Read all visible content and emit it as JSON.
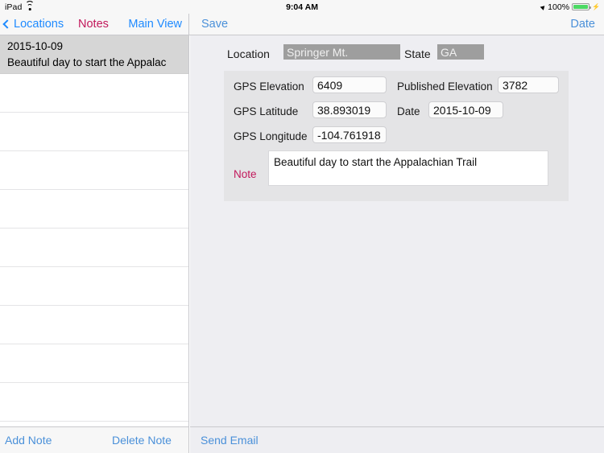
{
  "status_bar": {
    "device": "iPad",
    "wifi_icon": "wifi-icon",
    "time": "9:04 AM",
    "location_icon": "location-arrow-icon",
    "battery_percent": "100%",
    "battery_icon": "battery-icon",
    "charging_icon": "charging-bolt-icon",
    "battery_color": "#4cd964"
  },
  "nav_bar": {
    "back_label": "Locations",
    "back_icon": "chevron-left-icon",
    "title": "Notes",
    "title_color": "#c2185b",
    "main_view_label": "Main View",
    "save_label": "Save",
    "date_label": "Date",
    "tint_color": "#4a90d9"
  },
  "sidebar": {
    "notes": [
      {
        "date": "2015-10-09",
        "preview": "Beautiful day to start the Appalac",
        "selected": true
      },
      {
        "date": "",
        "preview": "",
        "selected": false
      },
      {
        "date": "",
        "preview": "",
        "selected": false
      },
      {
        "date": "",
        "preview": "",
        "selected": false
      },
      {
        "date": "",
        "preview": "",
        "selected": false
      },
      {
        "date": "",
        "preview": "",
        "selected": false
      },
      {
        "date": "",
        "preview": "",
        "selected": false
      },
      {
        "date": "",
        "preview": "",
        "selected": false
      },
      {
        "date": "",
        "preview": "",
        "selected": false
      },
      {
        "date": "",
        "preview": "",
        "selected": false
      }
    ],
    "toolbar": {
      "add_label": "Add Note",
      "delete_label": "Delete Note"
    }
  },
  "detail": {
    "location": {
      "label": "Location",
      "value": "Springer Mt."
    },
    "state": {
      "label": "State",
      "value": "GA"
    },
    "gps_elevation": {
      "label": "GPS Elevation",
      "value": "6409"
    },
    "published_elevation": {
      "label": "Published Elevation",
      "value": "3782"
    },
    "gps_latitude": {
      "label": "GPS Latitude",
      "value": "38.893019"
    },
    "date": {
      "label": "Date",
      "value": "2015-10-09"
    },
    "gps_longitude": {
      "label": "GPS Longitude",
      "value": "-104.761918"
    },
    "note": {
      "label": "Note",
      "label_color": "#c2185b",
      "value": "Beautiful day to start the Appalachian Trail"
    },
    "toolbar": {
      "send_email_label": "Send Email"
    }
  }
}
